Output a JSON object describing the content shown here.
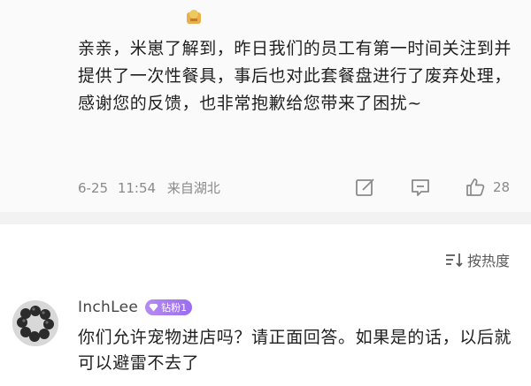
{
  "reply": {
    "text": "亲亲，米崽了解到，昨日我们的员工有第一时间关注到并提供了一次性餐具，事后也对此套餐盘进行了废弃处理，感谢您的反馈，也非常抱歉给您带来了困扰~",
    "date": "6-25",
    "time": "11:54",
    "location": "来自湖北",
    "like_count": "28"
  },
  "sort": {
    "label": "按热度"
  },
  "comment": {
    "username": "InchLee",
    "badge": "钻粉1",
    "text": "你们允许宠物进店吗？请正面回答。如果是的话，以后就可以避雷不去了"
  },
  "colors": {
    "badge": "#a77cf0",
    "meta_text": "#8a8a8a",
    "divider": "#f2f2f2"
  },
  "icons": {
    "share": "share-edit-icon",
    "comment": "comment-icon",
    "like": "thumbs-up-icon",
    "sort": "sort-icon",
    "badge": "diamond-icon"
  }
}
